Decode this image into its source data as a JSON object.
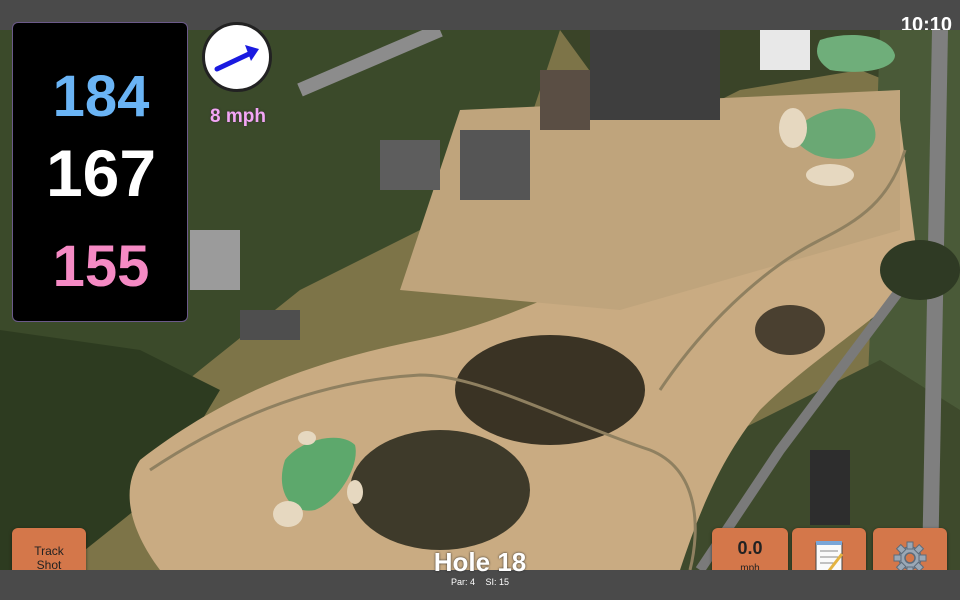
{
  "status": {
    "time": "10:10"
  },
  "distances": {
    "back": "184",
    "middle": "167",
    "front": "155"
  },
  "wind": {
    "speed_label": "8 mph",
    "icon": "wind-arrow-icon"
  },
  "buttons": {
    "track_shot_line1": "Track",
    "track_shot_line2": "Shot",
    "speed_value": "0.0",
    "speed_unit": "mph",
    "notes_icon": "notepad-icon",
    "settings_icon": "gear-icon"
  },
  "hole": {
    "title": "Hole 18",
    "par": "Par: 4",
    "si": "SI: 15"
  },
  "colors": {
    "back": "#6ab4f5",
    "middle": "#ffffff",
    "front": "#f58ac4",
    "wind_text": "#f3a6f5",
    "button": "#d4774a"
  }
}
